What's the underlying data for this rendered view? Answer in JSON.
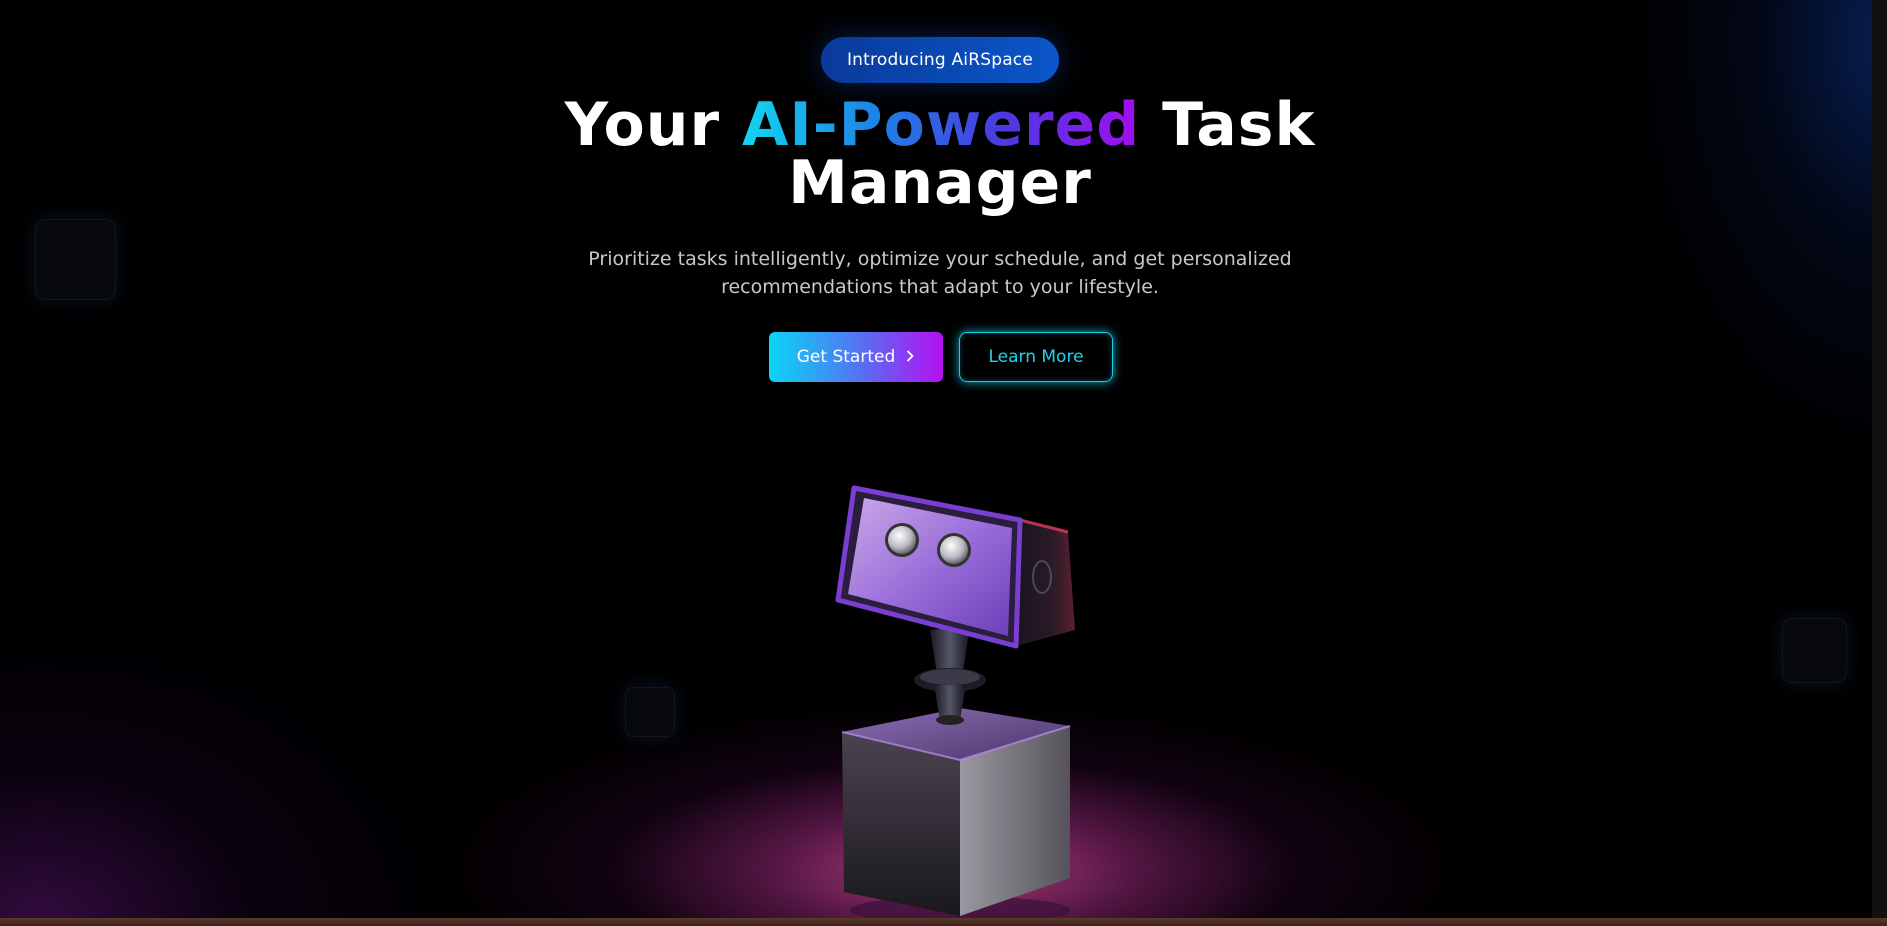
{
  "hero": {
    "badge": "Introducing AiRSpace",
    "headline_part1": "Your ",
    "headline_highlight": "AI-Powered",
    "headline_part2": " Task Manager",
    "subtitle": "Prioritize tasks intelligently, optimize your schedule, and get personalized recommendations that adapt to your lifestyle.",
    "primary_button": "Get Started",
    "primary_button_icon": "chevron-right-icon",
    "secondary_button": "Learn More"
  },
  "colors": {
    "background": "#000000",
    "badge": "#0b4fbf",
    "accent_cyan": "#12d6f0",
    "accent_purple": "#a10ff0",
    "spotlight": "#d64896"
  }
}
